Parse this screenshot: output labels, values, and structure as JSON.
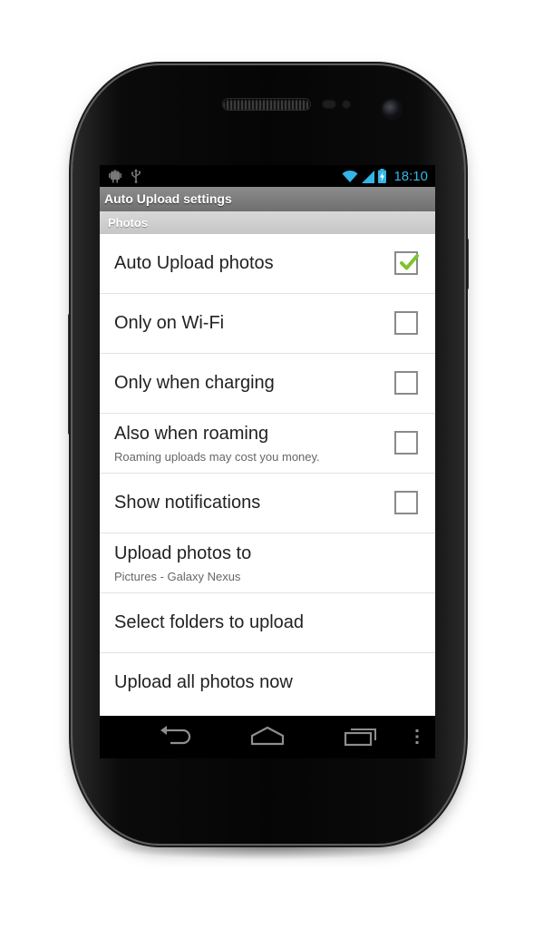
{
  "status_bar": {
    "time": "18:10",
    "icons_left": [
      "android-debug-icon",
      "usb-icon"
    ],
    "icons_right": [
      "wifi-icon",
      "signal-icon",
      "battery-charging-icon"
    ],
    "accent_color": "#33b5e5"
  },
  "screen": {
    "title": "Auto Upload settings",
    "section_header": "Photos"
  },
  "preferences": [
    {
      "title": "Auto Upload photos",
      "summary": "",
      "checkbox": true,
      "checked": true
    },
    {
      "title": "Only on Wi-Fi",
      "summary": "",
      "checkbox": true,
      "checked": false
    },
    {
      "title": "Only when charging",
      "summary": "",
      "checkbox": true,
      "checked": false
    },
    {
      "title": "Also when roaming",
      "summary": "Roaming uploads may cost you money.",
      "checkbox": true,
      "checked": false
    },
    {
      "title": "Show notifications",
      "summary": "",
      "checkbox": true,
      "checked": false
    },
    {
      "title": "Upload photos to",
      "summary": "Pictures - Galaxy Nexus",
      "checkbox": false
    },
    {
      "title": "Select folders to upload",
      "summary": "",
      "checkbox": false
    },
    {
      "title": "Upload all photos now",
      "summary": "",
      "checkbox": false
    }
  ],
  "nav_bar": {
    "buttons": [
      "back-icon",
      "home-icon",
      "recent-apps-icon",
      "menu-overflow-icon"
    ]
  },
  "colors": {
    "checkmark": "#7dc52e",
    "title_bar": "#7f7f7f",
    "section_header": "#cfcfcf"
  }
}
